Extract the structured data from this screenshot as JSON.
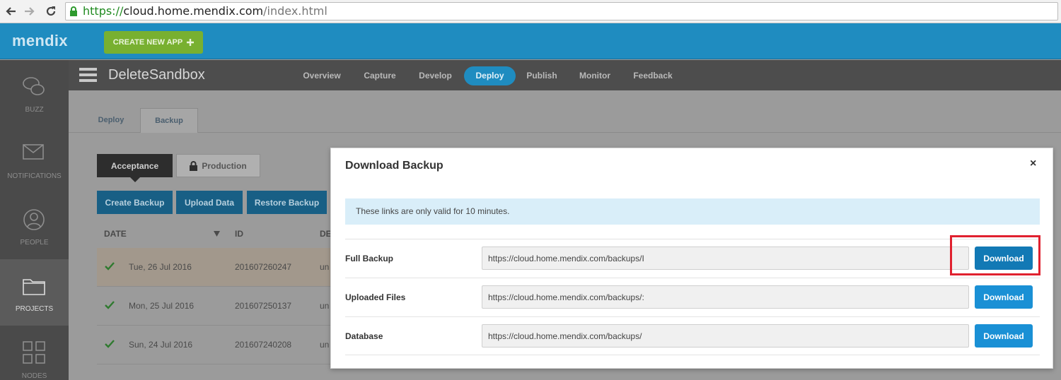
{
  "browser": {
    "url_scheme": "https://",
    "url_host": "cloud.home.mendix.com",
    "url_path": "/index.html"
  },
  "topbar": {
    "logo": "mendix",
    "create_app_label": "CREATE NEW APP",
    "create_app_icon": "plus-icon",
    "brand_color": "#1f8cc0",
    "create_color": "#78b030"
  },
  "sidebar": {
    "items": [
      {
        "label": "BUZZ",
        "icon": "chat-bubbles-icon"
      },
      {
        "label": "NOTIFICATIONS",
        "icon": "envelope-icon"
      },
      {
        "label": "PEOPLE",
        "icon": "person-icon"
      },
      {
        "label": "PROJECTS",
        "icon": "folder-icon",
        "active": true
      },
      {
        "label": "NODES",
        "icon": "grid-icon"
      }
    ]
  },
  "project": {
    "title": "DeleteSandbox",
    "nav": [
      "Overview",
      "Capture",
      "Develop",
      "Deploy",
      "Publish",
      "Monitor",
      "Feedback"
    ],
    "active_nav": "Deploy"
  },
  "subtabs": {
    "items": [
      "Deploy",
      "Backup"
    ],
    "active": "Backup"
  },
  "environments": {
    "acceptance": "Acceptance",
    "production": "Production"
  },
  "actions": {
    "create_backup": "Create Backup",
    "upload_data": "Upload Data",
    "restore_backup": "Restore Backup"
  },
  "table": {
    "headers": {
      "date": "DATE",
      "id": "ID",
      "description": "DE"
    },
    "rows": [
      {
        "date": "Tue, 26 Jul 2016",
        "id": "201607260247",
        "desc": "un",
        "selected": true
      },
      {
        "date": "Mon, 25 Jul 2016",
        "id": "201607250137",
        "desc": "un"
      },
      {
        "date": "Sun, 24 Jul 2016",
        "id": "201607240208",
        "desc": "un"
      }
    ]
  },
  "modal": {
    "title": "Download Backup",
    "close": "×",
    "alert": "These links are only valid for 10 minutes.",
    "rows": [
      {
        "label": "Full Backup",
        "value": "https://cloud.home.mendix.com/backups/I",
        "button": "Download"
      },
      {
        "label": "Uploaded Files",
        "value": "https://cloud.home.mendix.com/backups/:",
        "button": "Download"
      },
      {
        "label": "Database",
        "value": "https://cloud.home.mendix.com/backups/",
        "button": "Download"
      }
    ],
    "button_color": "#1a90d5",
    "highlight_color": "#e0212f"
  }
}
